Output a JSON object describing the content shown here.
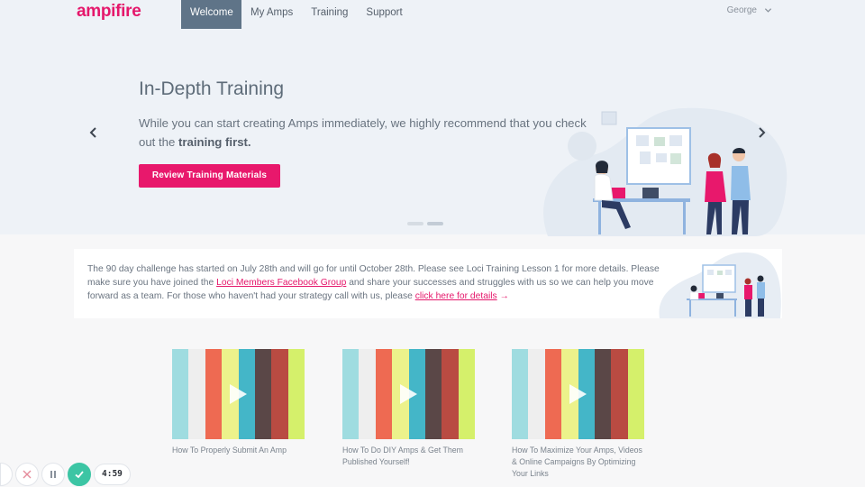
{
  "brand": {
    "logo": "ampifire",
    "color": "#e5176b"
  },
  "nav": {
    "items": [
      {
        "label": "Welcome",
        "active": true
      },
      {
        "label": "My Amps",
        "active": false
      },
      {
        "label": "Training",
        "active": false
      },
      {
        "label": "Support",
        "active": false
      }
    ],
    "user": "George"
  },
  "hero": {
    "title": "In-Depth Training",
    "text_pre": "While you can start creating Amps immediately, we highly recommend that you check out the ",
    "text_bold": "training first.",
    "button_label": "Review Training Materials",
    "slide_count": 2,
    "active_slide": 2
  },
  "announcement": {
    "part1": "The 90 day challenge has started on July 28th and will go for until October 28th. Please see Loci Training Lesson 1 for more details. Please make sure you have joined the ",
    "link1": "Loci Members Facebook Group",
    "part2": " and share your successes and struggles with us so we can help you move forward as a team. For those who haven't had your strategy call with us, please ",
    "link2": "click here for details",
    "link2_arrow": "→"
  },
  "videos": [
    {
      "title": "How To Properly Submit An Amp"
    },
    {
      "title": "How To Do DIY Amps & Get Them Published Yourself!"
    },
    {
      "title": "How To Maximize Your Amps, Videos & Online Campaigns By Optimizing Your Links"
    }
  ],
  "thumbnail_colors": [
    "#9fdce0",
    "#eeeeee",
    "#ee6a52",
    "#ecf28b",
    "#44b6c8",
    "#5a4747",
    "#b94b42",
    "#d5f06b"
  ],
  "recorder": {
    "timer": "4:59",
    "check_color": "#3cc5a4"
  }
}
